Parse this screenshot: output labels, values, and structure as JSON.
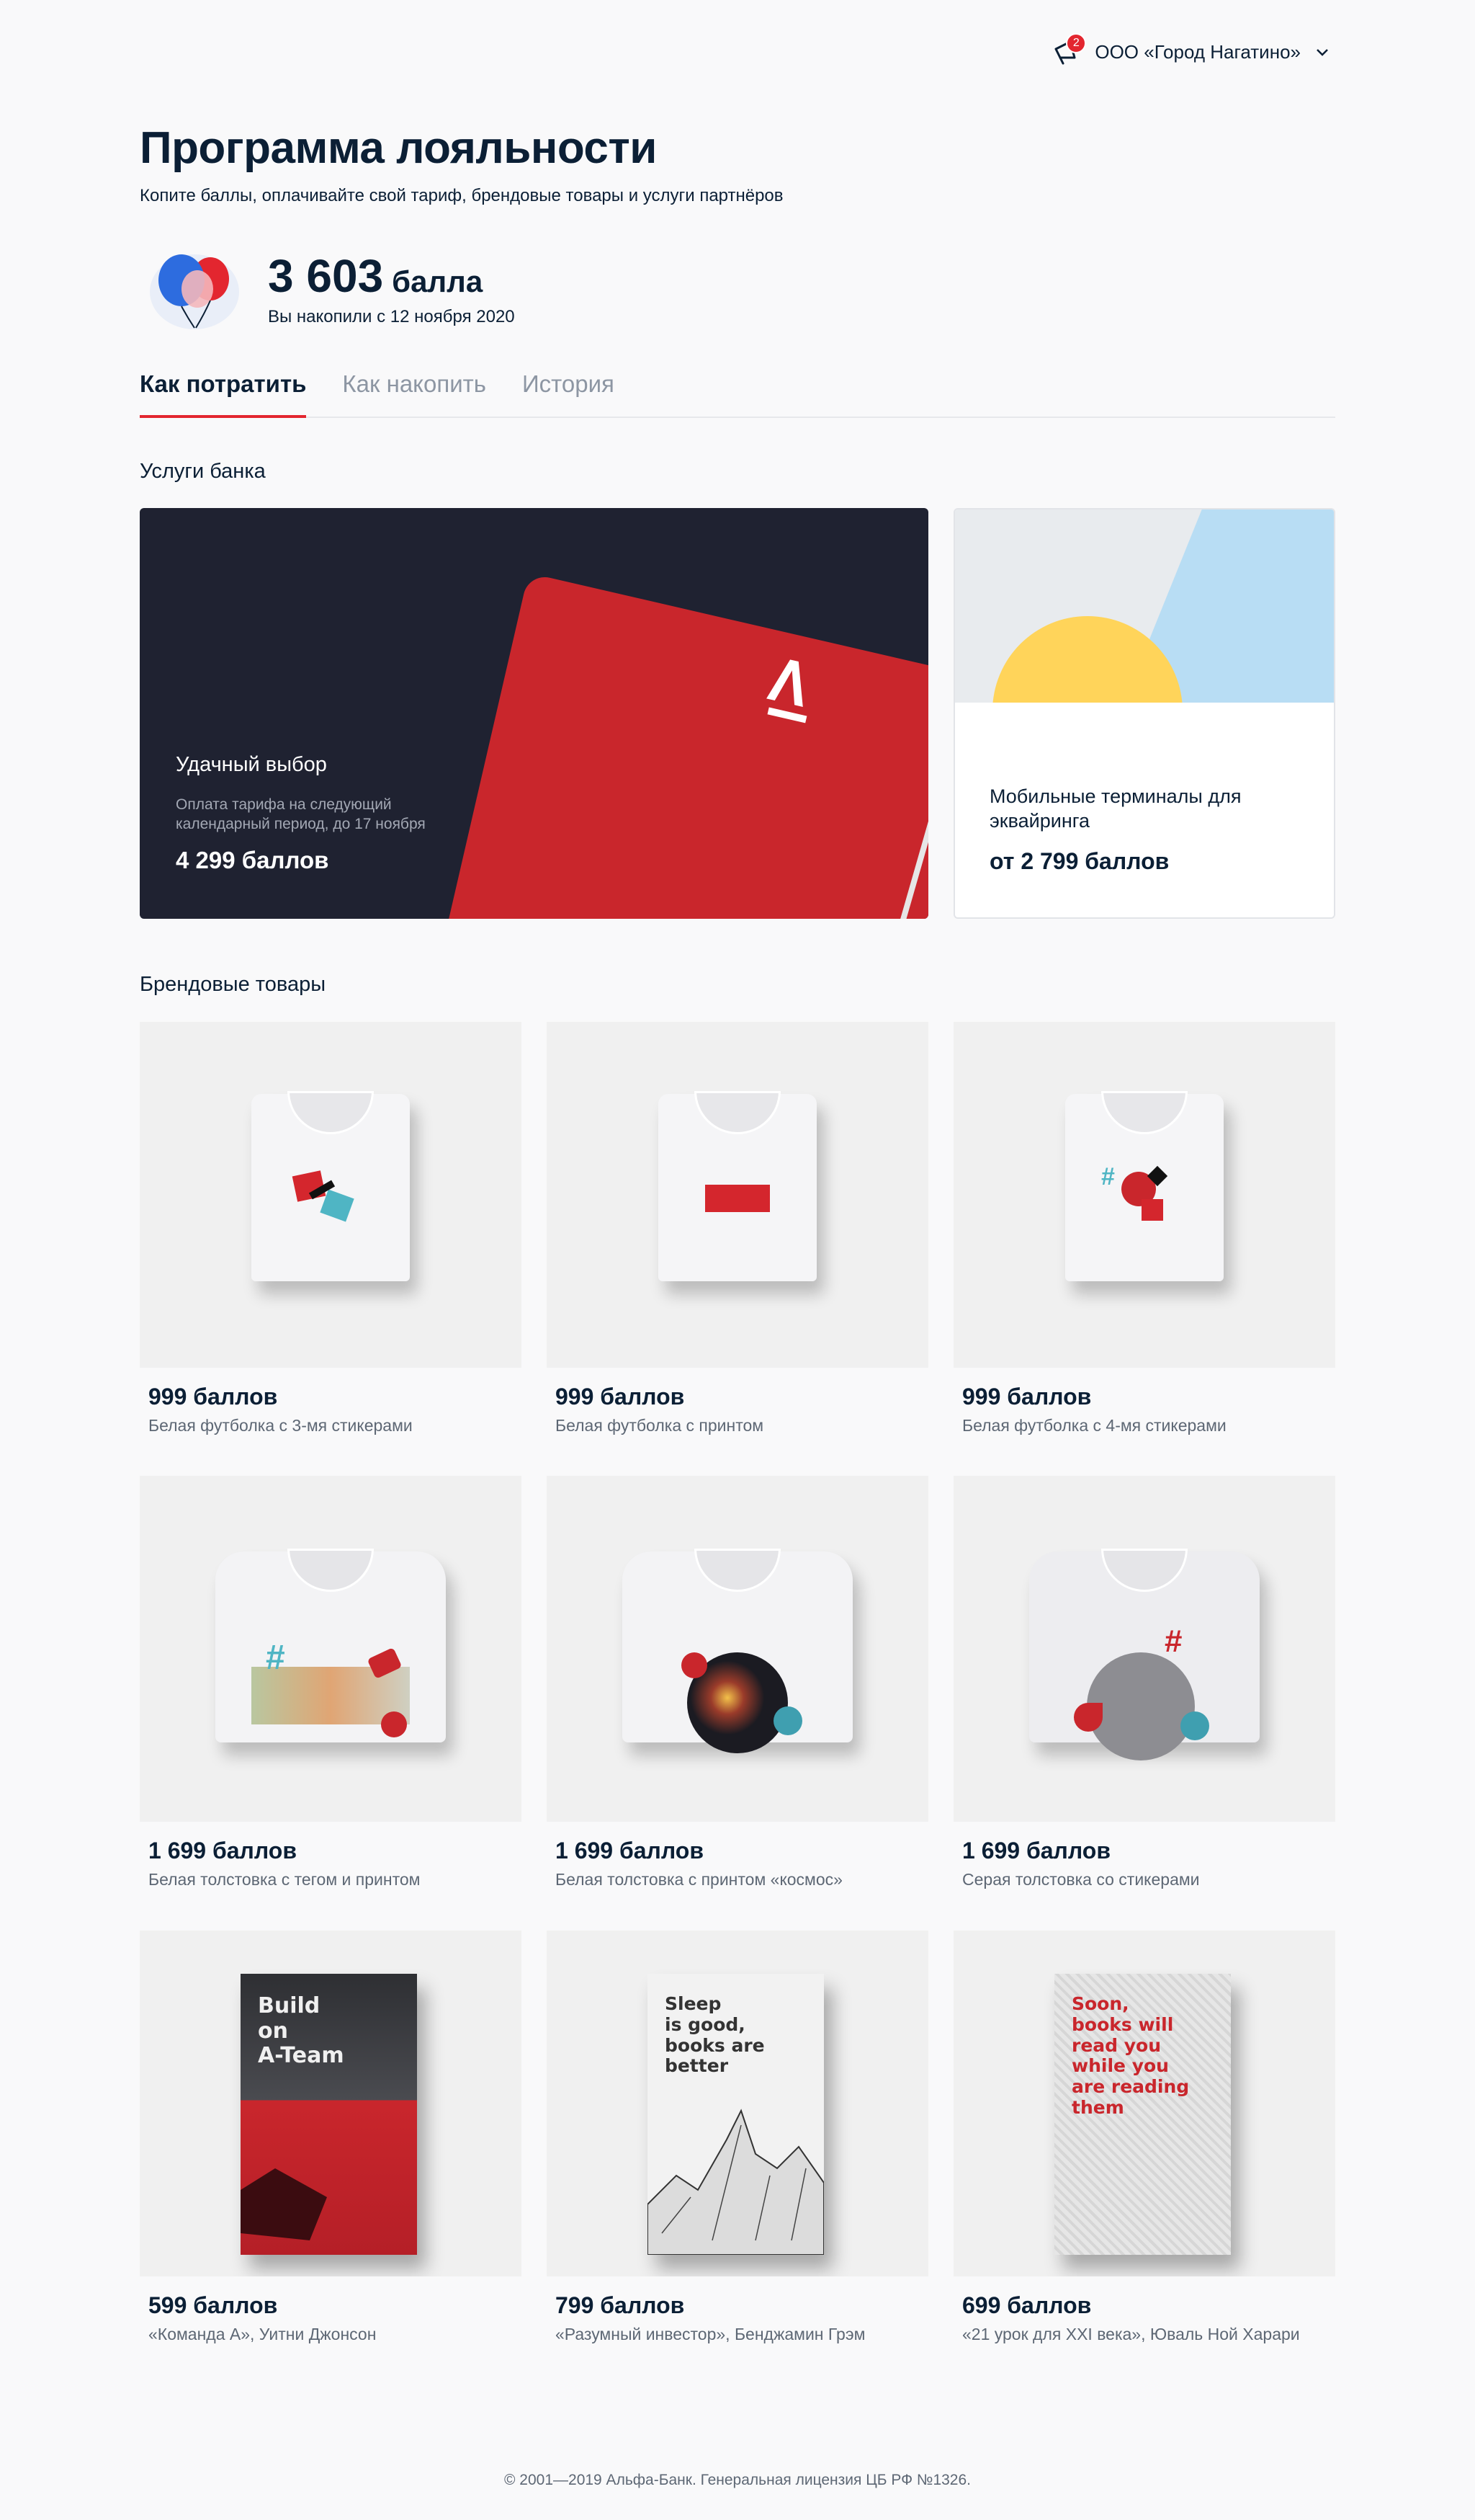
{
  "header": {
    "notifications_count": "2",
    "company": "ООО «Город Нагатино»"
  },
  "page": {
    "title": "Программа лояльности",
    "subtitle": "Копите баллы, оплачивайте свой тариф, брендовые товары и услуги партнёров"
  },
  "points": {
    "value": "3 603",
    "unit": "балла",
    "since": "Вы накопили с 12 ноября 2020"
  },
  "tabs": [
    {
      "label": "Как потратить",
      "active": true
    },
    {
      "label": "Как накопить",
      "active": false
    },
    {
      "label": "История",
      "active": false
    }
  ],
  "bank_services": {
    "title": "Услуги банка",
    "items": [
      {
        "title": "Удачный выбор",
        "description": "Оплата тарифа на следующий календарный период, до 17 ноября",
        "price": "4 299 баллов"
      },
      {
        "title": "Мобильные терминалы для эквайринга",
        "price": "от 2 799 баллов"
      }
    ]
  },
  "brand_goods": {
    "title": "Брендовые товары",
    "items": [
      {
        "price": "999 баллов",
        "name": "Белая футболка  с 3-мя стикерами"
      },
      {
        "price": "999 баллов",
        "name": "Белая футболка с принтом"
      },
      {
        "price": "999 баллов",
        "name": "Белая футболка с 4-мя стикерами"
      },
      {
        "price": "1 699 баллов",
        "name": "Белая толстовка с тегом и принтом"
      },
      {
        "price": "1 699 баллов",
        "name": "Белая толстовка с принтом «космос»"
      },
      {
        "price": "1 699 баллов",
        "name": "Серая толстовка со стикерами"
      },
      {
        "price": "599 баллов",
        "name": "«Команда А», Уитни Джонсон",
        "cover_text": "Build\non\nA-Team"
      },
      {
        "price": "799 баллов",
        "name": "«Разумный инвестор», Бенджамин Грэм",
        "cover_text": "Sleep\nis good,\nbooks are\nbetter"
      },
      {
        "price": "699 баллов",
        "name": "«21 урок для XXI века», Юваль Ной Харари",
        "cover_text": "Soon,\nbooks will\nread you\nwhile you\nare reading\nthem"
      }
    ]
  },
  "footer": {
    "text": "© 2001—2019 Альфа-Банк. Генеральная лицензия ЦБ РФ №1326."
  },
  "colors": {
    "accent": "#e3262f",
    "dark_card": "#1f2231",
    "text": "#0b1f35"
  }
}
